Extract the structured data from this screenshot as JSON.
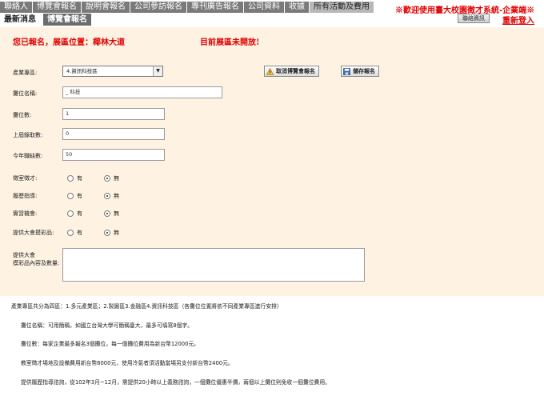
{
  "nav": {
    "menu": [
      "聯絡人",
      "博覽會報名",
      "說明會報名",
      "公司參訪報名",
      "專刊廣告報名",
      "公司資料",
      "收據",
      "所有活動及費用"
    ],
    "subtabs": [
      "最新消息",
      "博覽會報名"
    ],
    "notice": "※歡迎使用臺大校園徵才系統-企業端※",
    "info_button": "聯絡資訊",
    "relogin": "重新登入"
  },
  "status": {
    "registered": "您已報名，展區位置：椰林大道",
    "booth_closed": "目前展區未開放!"
  },
  "form": {
    "industry_label": "產業專區:",
    "industry_value": "4.資訊科技區",
    "cancel_button": "取消博覽會報名",
    "save_button": "儲存報名",
    "booth_name_label": "攤位名稱:",
    "booth_name_value": "_ 科技",
    "booth_count_label": "攤位數:",
    "booth_count_value": "1",
    "last_year_hires_label": "上屆錄取數:",
    "last_year_hires_value": "0",
    "this_year_openings_label": "今年職缺數:",
    "this_year_openings_value": "50",
    "radios": [
      {
        "label": "徵室徵才:",
        "yes": "有",
        "no": "無",
        "selected": "no"
      },
      {
        "label": "履歷指導:",
        "yes": "有",
        "no": "無",
        "selected": "no"
      },
      {
        "label": "實習機會:",
        "yes": "有",
        "no": "無",
        "selected": "no"
      },
      {
        "label": "提供大會摸彩品:",
        "yes": "有",
        "no": "無",
        "selected": "no"
      }
    ],
    "prize_label_1": "提供大會",
    "prize_label_2": "摸彩品內容及數量:"
  },
  "notes": [
    "產業專區共分為四區：1.多元產業區；2.製圖區3.金融區4.資訊科技區（各攤位位置將依不同產業專區進行安排）",
    "攤位名稱：可用簡稱，如國立台灣大學可簡稱臺大，最多可填寫8個字。",
    "攤位數：每家企業最多報名3個攤位，每一個攤位費用為新台幣12000元。",
    "教室徵才場地及設備費用新台幣8000元，使用冷氣者須活動當場另支付新台幣2400元。",
    "提供履歷指導諮詢，從102年3月~12月，需提供20小時以上義務諮詢，一個攤位優惠半價，兩個以上攤位則免收一個攤位費用。"
  ]
}
